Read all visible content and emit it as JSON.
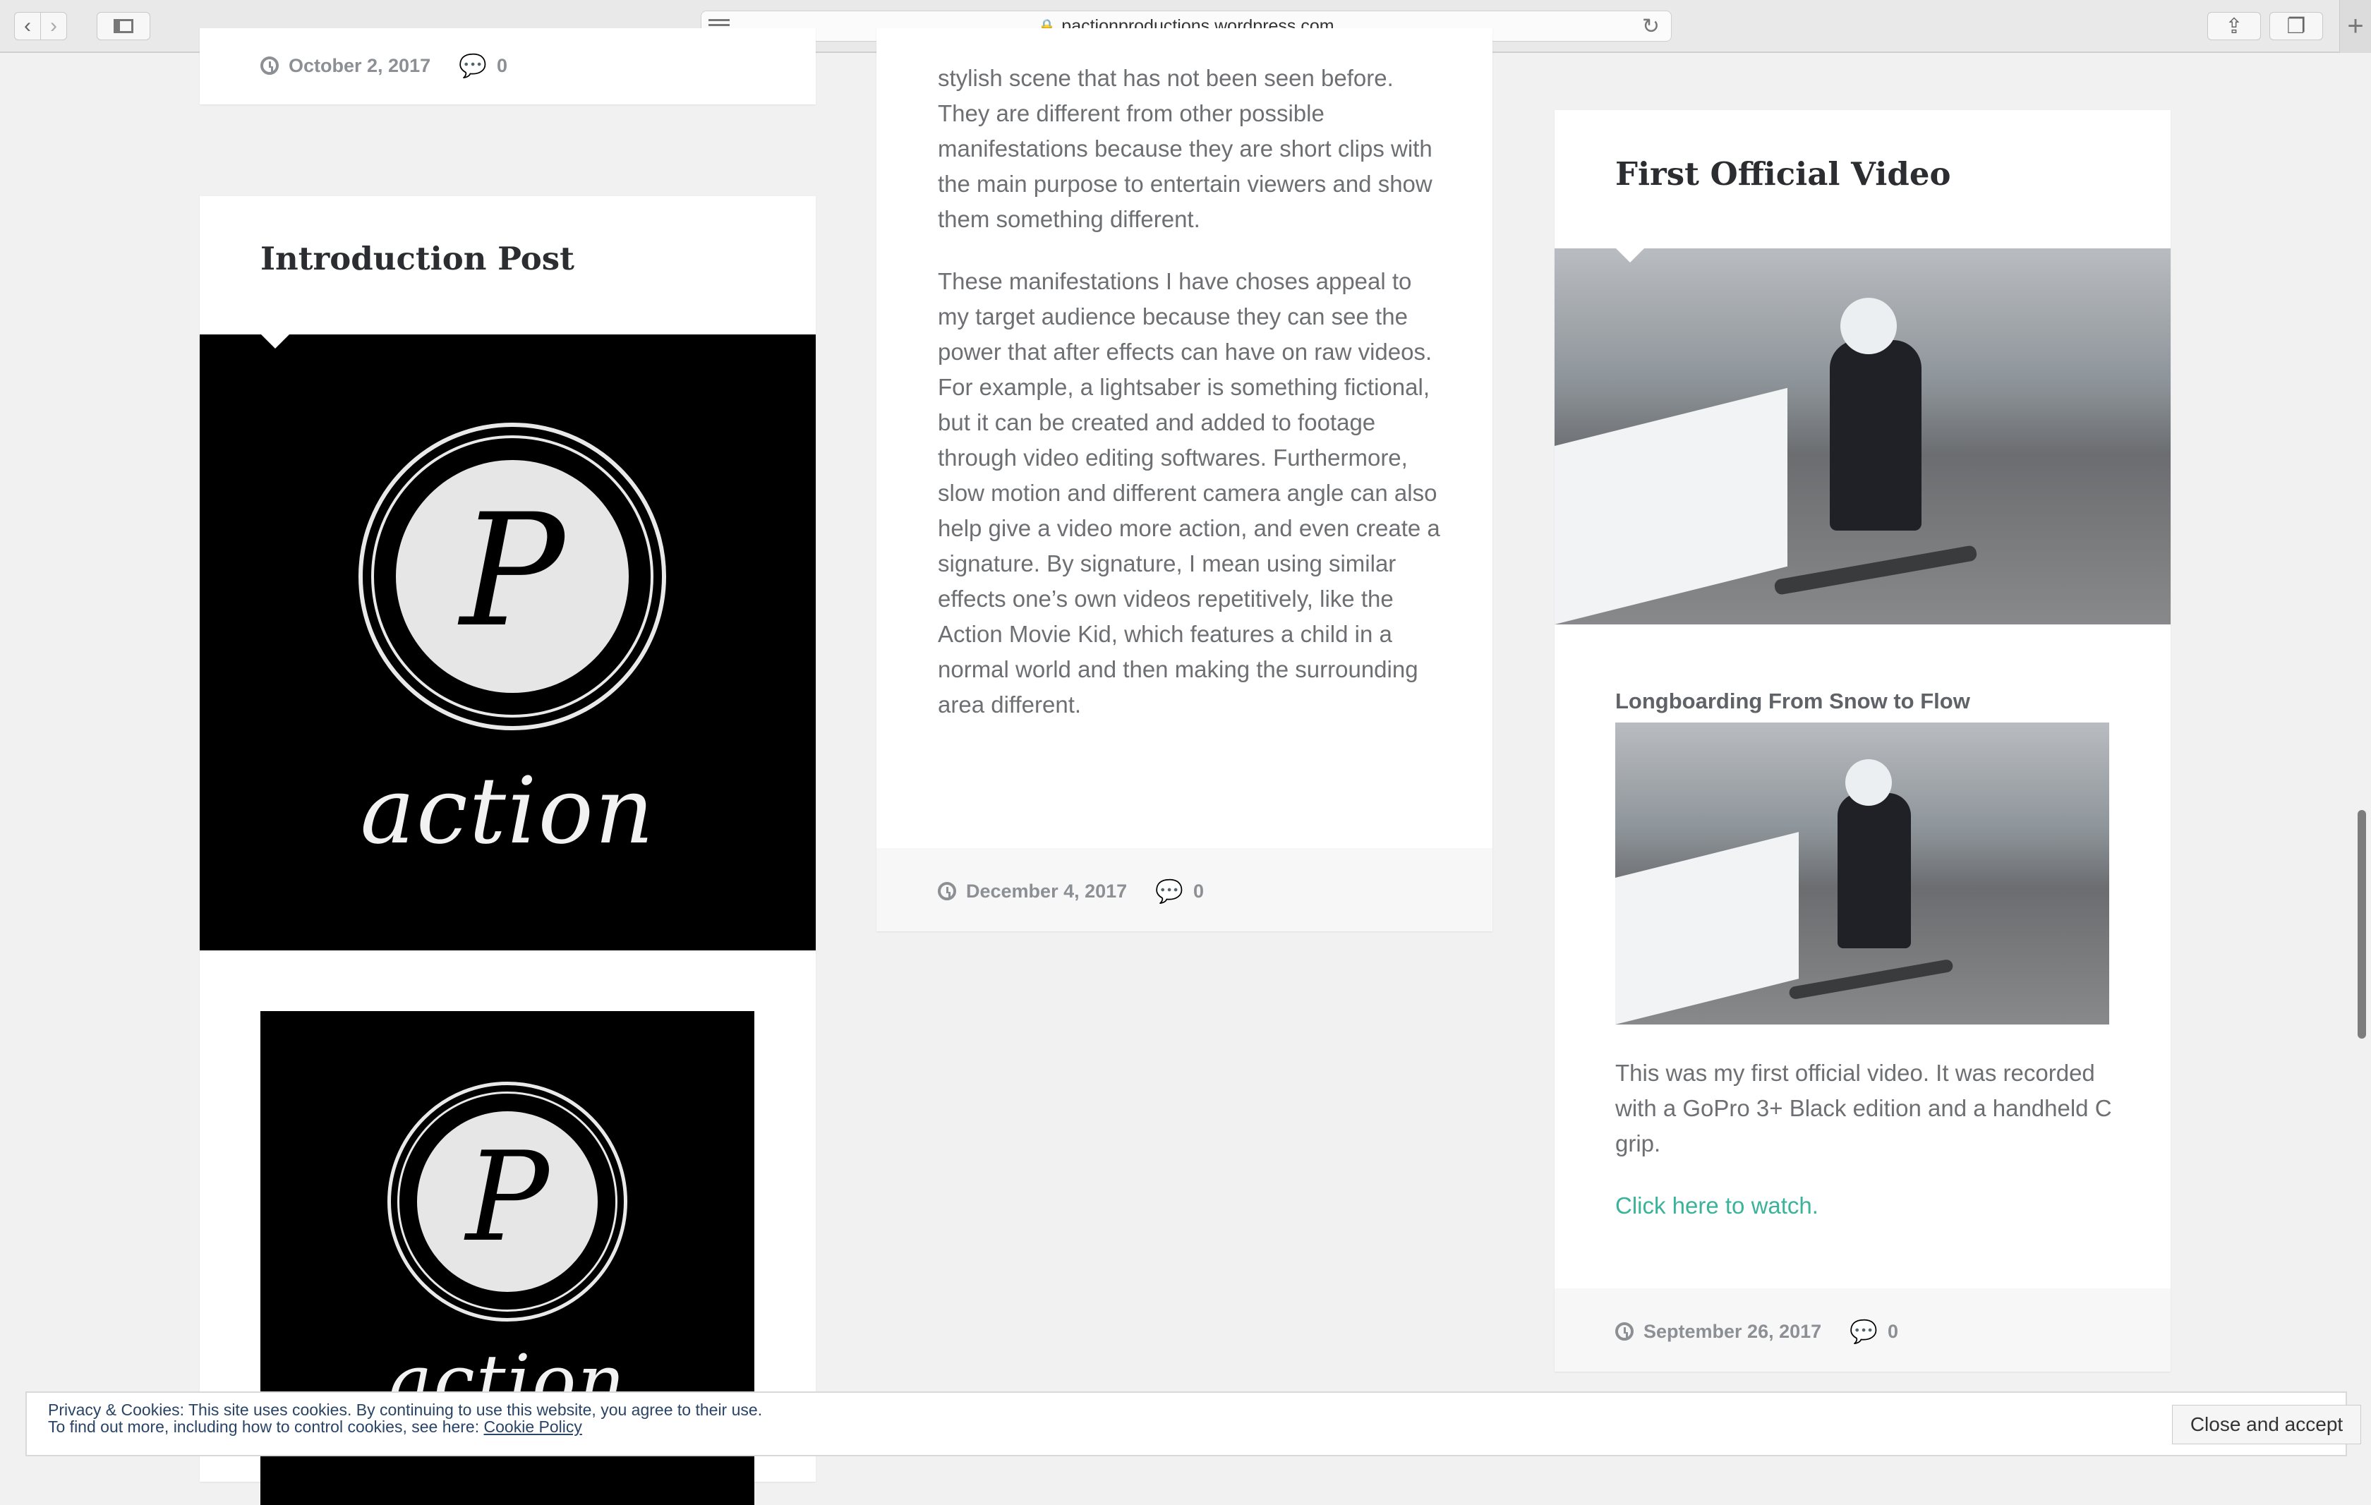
{
  "browser": {
    "url": "pactionproductions.wordpress.com",
    "back_icon": "chevron-left-icon",
    "forward_icon": "chevron-right-icon",
    "sidebar_icon": "sidebar-icon",
    "share_icon": "share-icon",
    "tabs_icon": "tabs-icon",
    "new_tab_label": "+"
  },
  "posts": {
    "top_left_meta": {
      "date": "October 2, 2017",
      "comments": "0"
    },
    "intro": {
      "title": "Introduction Post",
      "logo_letter": "P",
      "logo_word": "action"
    },
    "middle": {
      "paragraph1": "stylish scene that has not been seen before. They are different from other possible manifestations because they are short clips with the main purpose to entertain viewers and show them something different.",
      "paragraph2": "These manifestations I have choses appeal to my target audience because they can see the power that after effects can have on raw videos. For example, a lightsaber is something fictional, but it can be created and added to footage through video editing softwares. Furthermore, slow motion and different camera angle can also help give a video more action, and even create a signature. By signature, I mean using similar effects one’s own videos repetitively, like the Action Movie Kid, which features a child in a normal world and then making the surrounding area different.",
      "date": "December 4, 2017",
      "comments": "0"
    },
    "video_post": {
      "title": "First Official Video",
      "video_title": "Longboarding From Snow to Flow",
      "body": "This was my first official video. It was recorded with a GoPro 3+ Black edition and a handheld C grip.",
      "link": "Click here to watch.",
      "date": "September 26, 2017",
      "comments": "0"
    }
  },
  "cookie": {
    "line1": "Privacy & Cookies: This site uses cookies. By continuing to use this website, you agree to their use.",
    "line2": "To find out more, including how to control cookies, see here: ",
    "policy_link": "Cookie Policy",
    "button": "Close and accept"
  },
  "colors": {
    "link": "#3bb39a",
    "text": "#6d6f72",
    "meta": "#8c8f94"
  }
}
